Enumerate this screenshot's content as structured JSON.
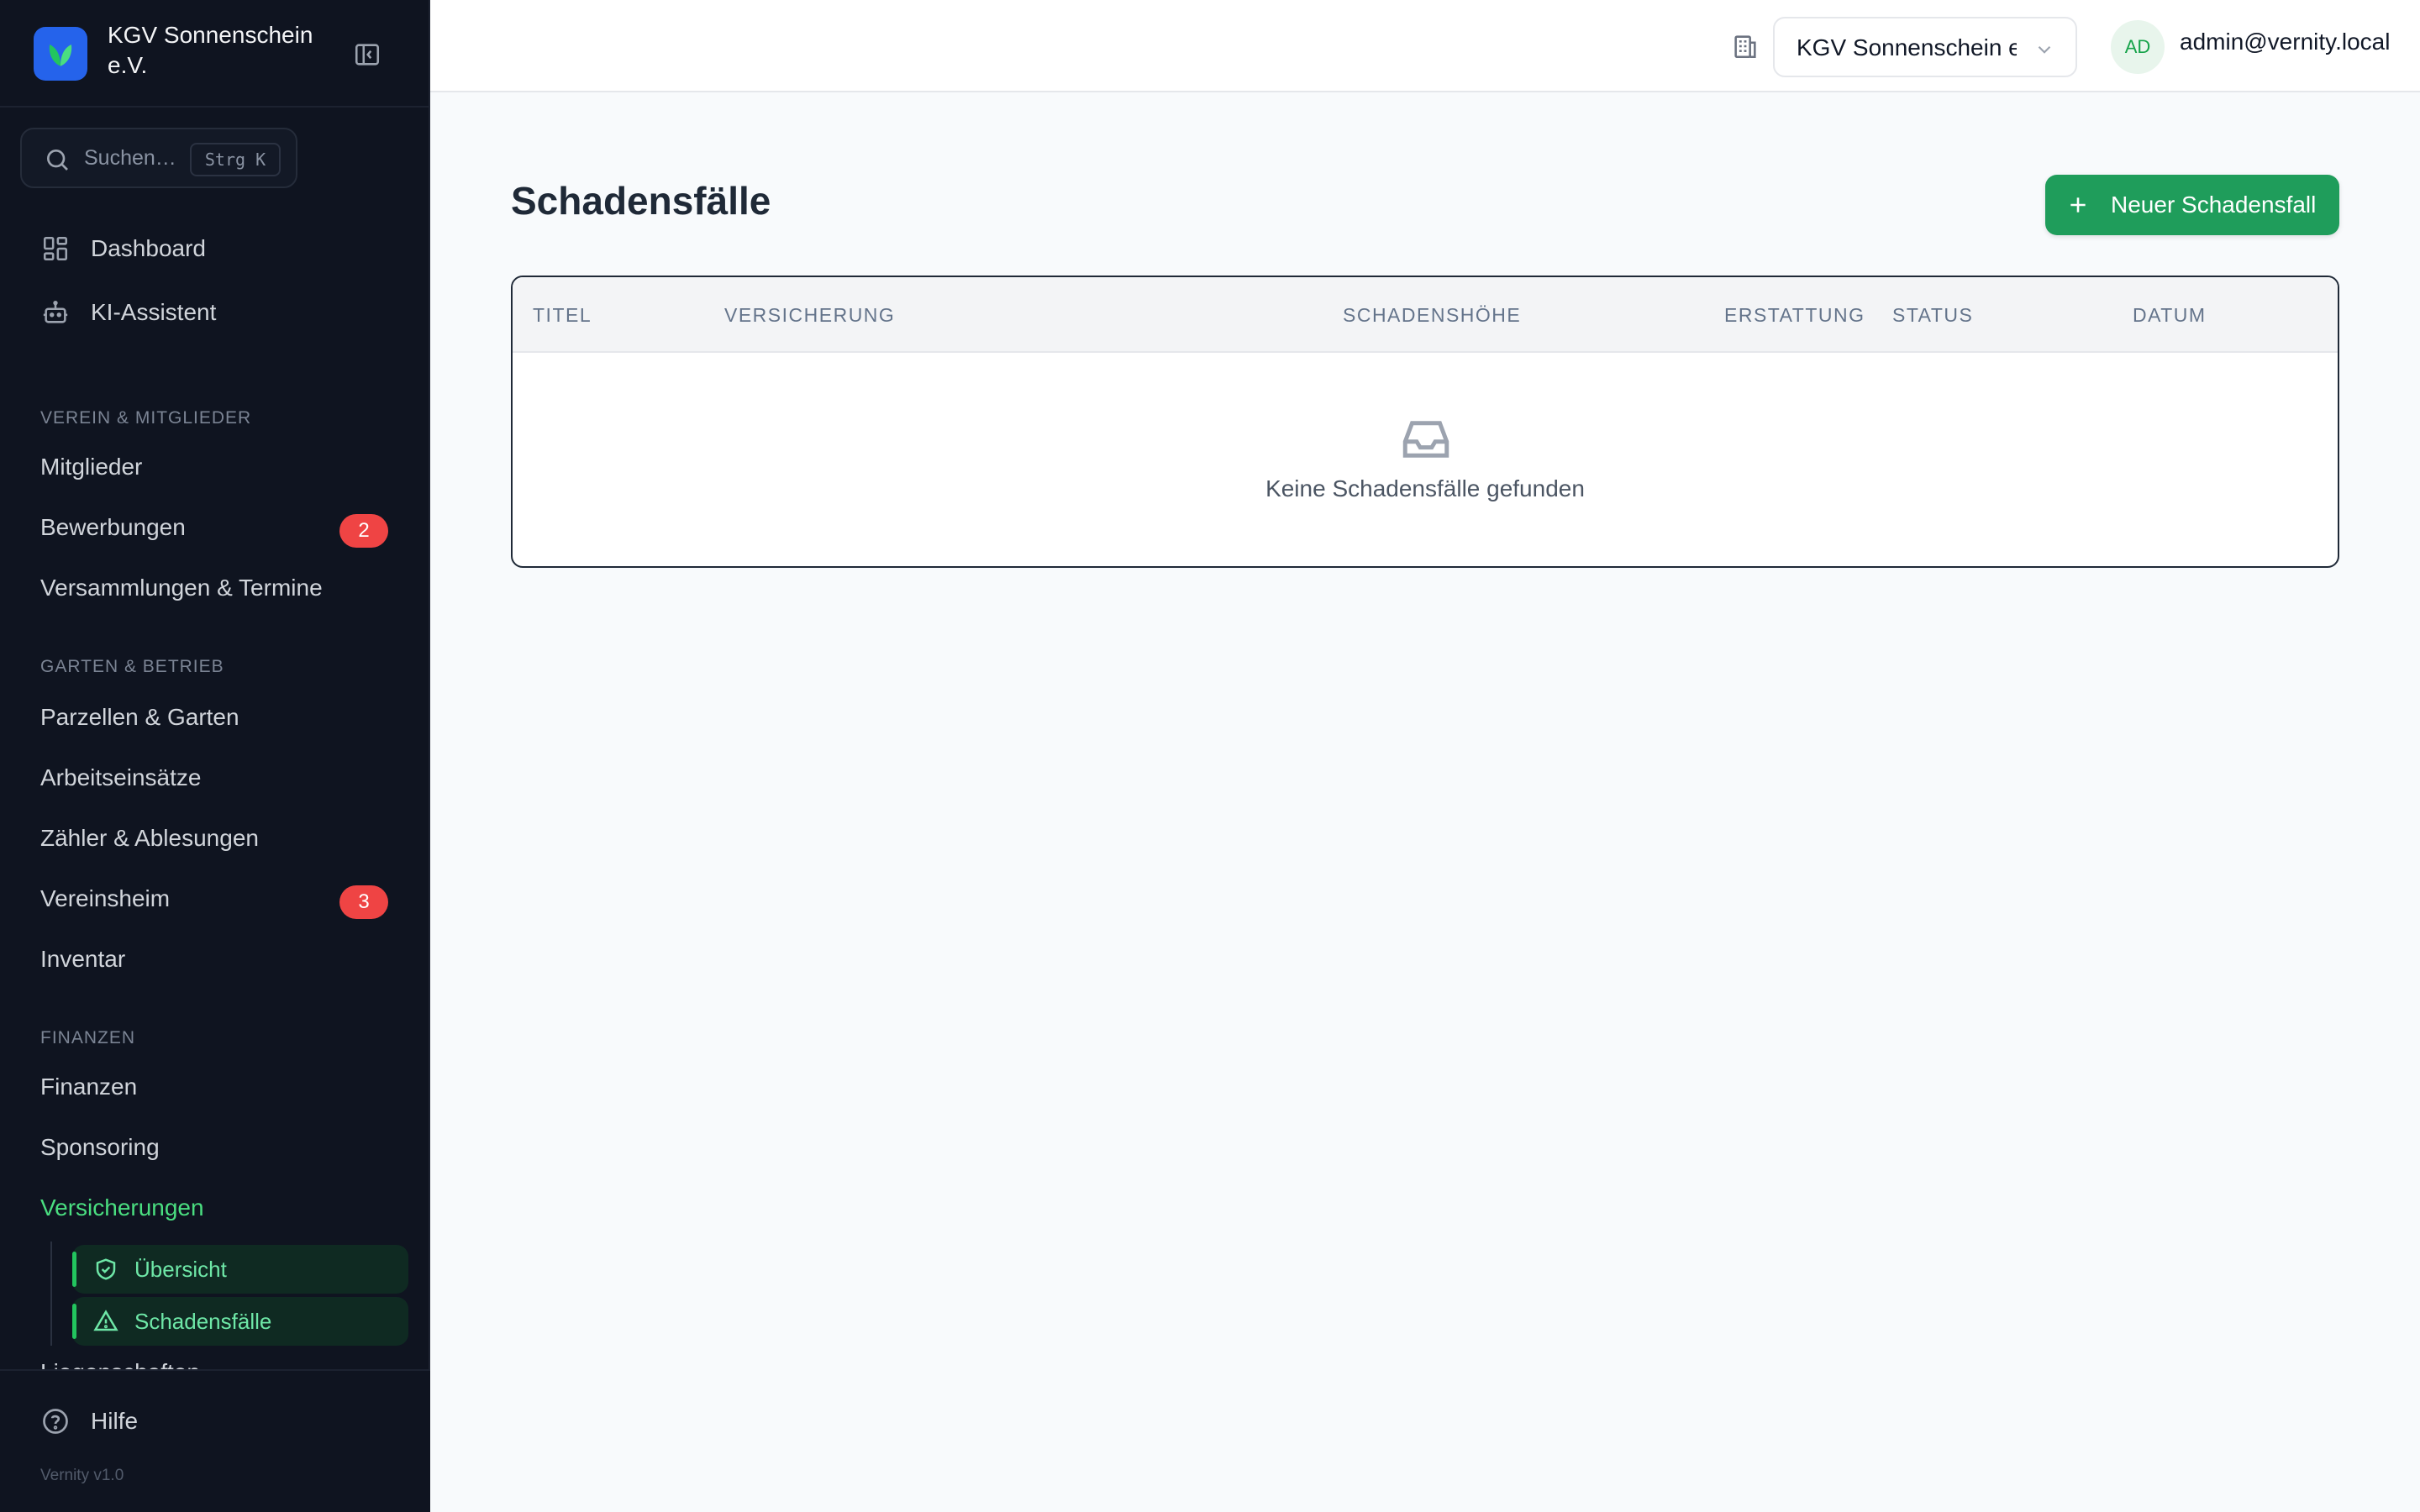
{
  "sidebar": {
    "brand_name": "KGV Sonnenschein e.V.",
    "search": {
      "placeholder": "Suchen…",
      "shortcut": "Strg K"
    },
    "top_items": [
      {
        "label": "Dashboard",
        "icon": "grid-icon"
      },
      {
        "label": "KI-Assistent",
        "icon": "bot-icon"
      }
    ],
    "sections": [
      {
        "title": "VEREIN & MITGLIEDER",
        "items": [
          {
            "label": "Mitglieder"
          },
          {
            "label": "Bewerbungen",
            "badge": "2"
          },
          {
            "label": "Versammlungen & Termine"
          }
        ]
      },
      {
        "title": "GARTEN & BETRIEB",
        "items": [
          {
            "label": "Parzellen & Garten"
          },
          {
            "label": "Arbeitseinsätze"
          },
          {
            "label": "Zähler & Ablesungen"
          },
          {
            "label": "Vereinsheim",
            "badge": "3"
          },
          {
            "label": "Inventar"
          }
        ]
      },
      {
        "title": "FINANZEN",
        "items": [
          {
            "label": "Finanzen"
          },
          {
            "label": "Sponsoring"
          },
          {
            "label": "Versicherungen",
            "active": true
          }
        ]
      }
    ],
    "subitems": [
      {
        "label": "Übersicht",
        "icon": "shield-check-icon"
      },
      {
        "label": "Schadensfälle",
        "icon": "warning-triangle-icon"
      }
    ],
    "cutoff_item": "Liegenschaften",
    "help_label": "Hilfe",
    "version": "Vernity v1.0"
  },
  "topbar": {
    "org_select": "KGV Sonnenschein e.V.",
    "avatar_initials": "AD",
    "user_email": "admin@vernity.local"
  },
  "main": {
    "title": "Schadensfälle",
    "new_button": "Neuer Schadensfall",
    "table": {
      "columns": [
        "TITEL",
        "VERSICHERUNG",
        "SCHADENSHÖHE",
        "ERSTATTUNG",
        "STATUS",
        "DATUM"
      ],
      "empty_text": "Keine Schadensfälle gefunden"
    }
  },
  "colors": {
    "sidebar_bg": "#0f1420",
    "accent": "#1f9d5b",
    "badge": "#ef4444",
    "active_text": "#4ade80"
  }
}
